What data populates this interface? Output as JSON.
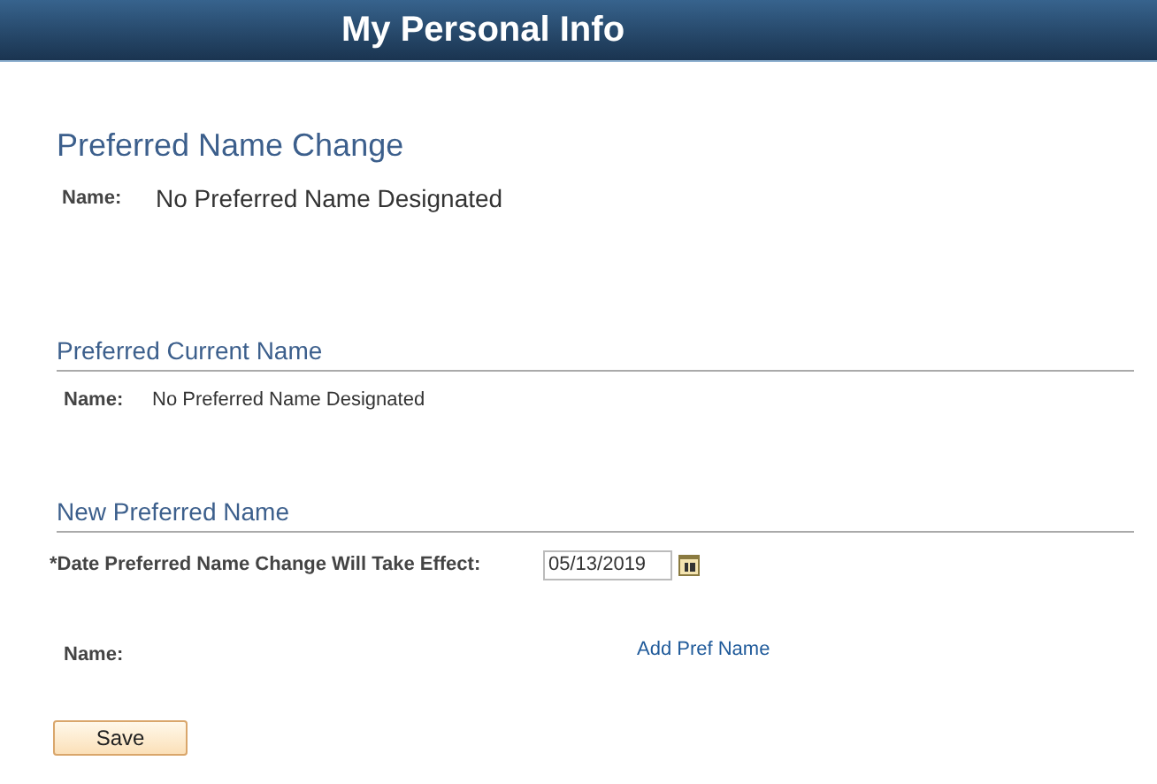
{
  "header": {
    "title": "My Personal Info"
  },
  "page_title": "Preferred Name Change",
  "summary": {
    "label": "Name:",
    "value": "No Preferred Name Designated"
  },
  "current_section": {
    "title": "Preferred Current Name",
    "label": "Name:",
    "value": "No Preferred Name Designated"
  },
  "new_section": {
    "title": "New Preferred Name",
    "date_label": "*Date Preferred Name Change Will Take Effect:",
    "date_value": "05/13/2019",
    "name_label": "Name:",
    "name_link": "Add Pref Name"
  },
  "buttons": [
    "Save"
  ]
}
